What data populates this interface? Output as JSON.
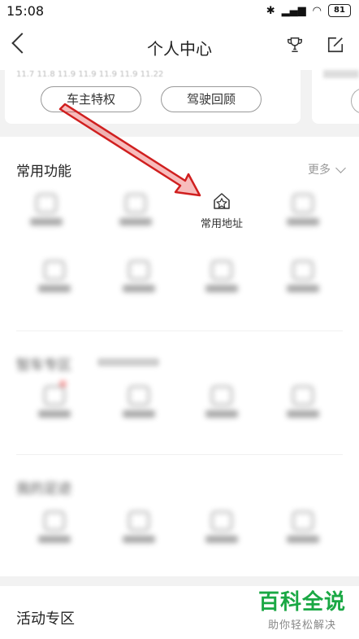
{
  "status": {
    "time": "15:08",
    "battery": "81"
  },
  "header": {
    "title": "个人中心"
  },
  "cards": {
    "pill_left": "车主特权",
    "pill_right": "驾驶回顾",
    "dates": "11.7 11.8 11.9 11.9 11.9 11.9 11.22"
  },
  "common": {
    "title": "常用功能",
    "more": "更多",
    "highlighted_item": "常用地址"
  },
  "section2": {
    "title": "智车专区"
  },
  "section3": {
    "title": "我的足迹"
  },
  "activity": {
    "title": "活动专区"
  },
  "watermark": {
    "main": "百科全说",
    "sub": "助你轻松解决"
  },
  "icons": [
    "back-icon",
    "trophy-icon",
    "edit-icon",
    "home-star-icon",
    "bluetooth-icon",
    "signal-icon",
    "wifi-icon",
    "battery-icon"
  ],
  "colors": {
    "arrow": "#d01f1f",
    "watermark": "#1aa844"
  }
}
